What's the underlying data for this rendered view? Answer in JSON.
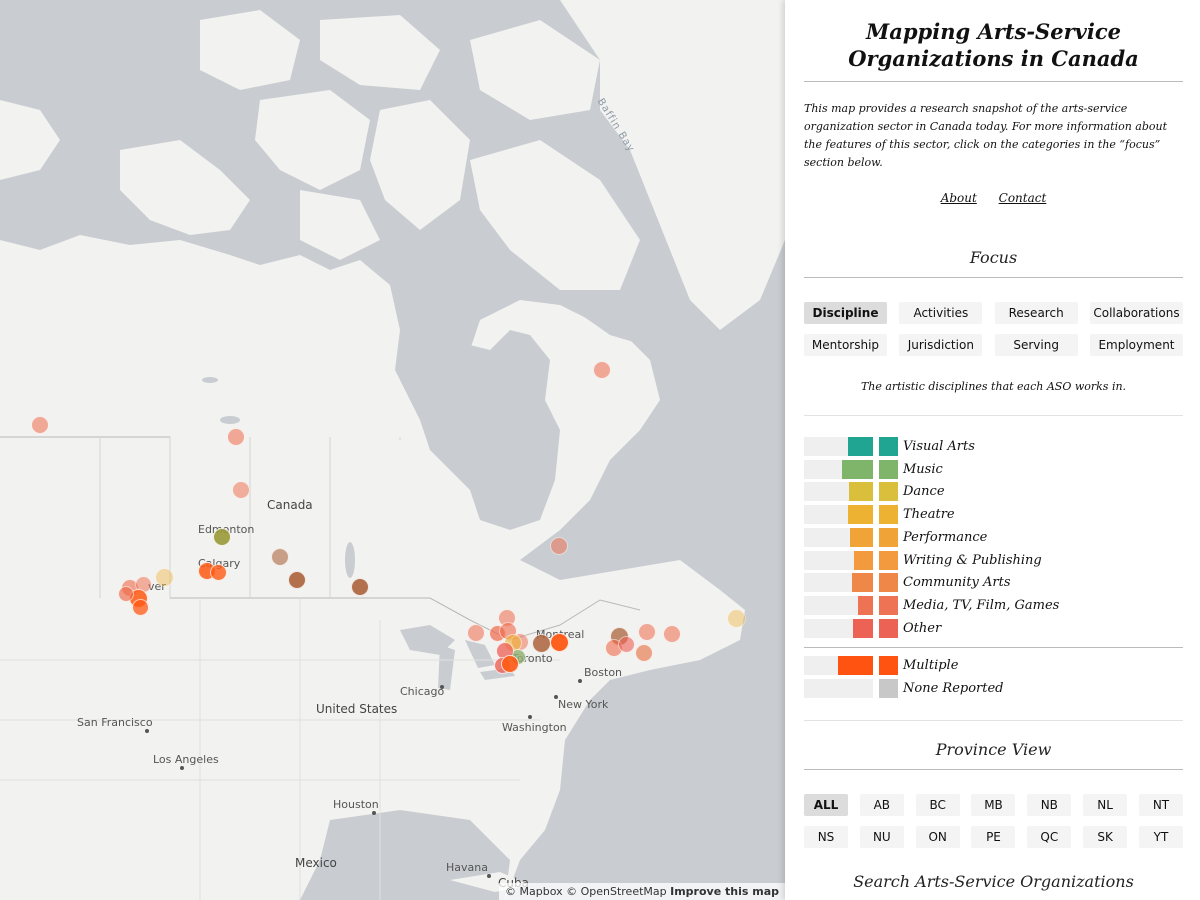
{
  "map": {
    "labels": {
      "canada": "Canada",
      "edmonton": "Edmonton",
      "calgary": "Calgary",
      "vancouver": "ver",
      "montreal": "Montreal",
      "toronto": "Toronto",
      "chicago": "Chicago",
      "boston": "Boston",
      "new_york": "New York",
      "washington": "Washington",
      "united_states": "United States",
      "san_francisco": "San Francisco",
      "los_angeles": "Los Angeles",
      "houston": "Houston",
      "mexico": "Mexico",
      "havana": "Havana",
      "cuba": "Cuba",
      "baffin_bay": "Baffin Bay"
    },
    "attribution": {
      "mapbox": "© Mapbox",
      "osm": "© OpenStreetMap",
      "improve": "Improve this map"
    },
    "marker_colors": {
      "music": "#8fb16f",
      "dance": "#d8bf42",
      "theatre": "#f0b030",
      "community": "#e8784a",
      "media": "#f06a4a",
      "other": "#ee6055",
      "multiple": "#ff5a14",
      "brown": "#a85a30",
      "olive": "#9a9a38"
    }
  },
  "panel": {
    "title": "Mapping Arts-Service Organizations in Canada",
    "intro": "This map provides a research snapshot of the arts-service organization sector in Canada today. For more information about the features of this sector, click on the categories in the “focus” section below.",
    "links": {
      "about": "About",
      "contact": "Contact"
    },
    "focus": {
      "heading": "Focus",
      "buttons": [
        "Discipline",
        "Activities",
        "Research",
        "Collaborations",
        "Mentorship",
        "Jurisdiction",
        "Serving",
        "Employment"
      ],
      "active": "Discipline",
      "description": "The artistic disciplines that each ASO works in."
    },
    "legend": [
      {
        "label": "Visual Arts",
        "color": "#1fa592",
        "share": 0.36
      },
      {
        "label": "Music",
        "color": "#7fb56a",
        "share": 0.45
      },
      {
        "label": "Dance",
        "color": "#d9bf3c",
        "share": 0.35
      },
      {
        "label": "Theatre",
        "color": "#eeb232",
        "share": 0.36
      },
      {
        "label": "Performance",
        "color": "#f0a437",
        "share": 0.33
      },
      {
        "label": "Writing & Publishing",
        "color": "#f29a3d",
        "share": 0.28
      },
      {
        "label": "Community Arts",
        "color": "#ef8748",
        "share": 0.3
      },
      {
        "label": "Media, TV, Film, Games",
        "color": "#ee7355",
        "share": 0.22
      },
      {
        "label": "Other",
        "color": "#ec6255",
        "share": 0.29
      }
    ],
    "legend_extra": [
      {
        "label": "Multiple",
        "color": "#ff5411",
        "share": 0.51
      },
      {
        "label": "None Reported",
        "color": "#c8c8c8",
        "share": 0.0
      }
    ],
    "province": {
      "heading": "Province View",
      "buttons": [
        "ALL",
        "AB",
        "BC",
        "MB",
        "NB",
        "NL",
        "NT",
        "NS",
        "NU",
        "ON",
        "PE",
        "QC",
        "SK",
        "YT"
      ],
      "active": "ALL"
    },
    "search_heading": "Search Arts-Service Organizations"
  }
}
